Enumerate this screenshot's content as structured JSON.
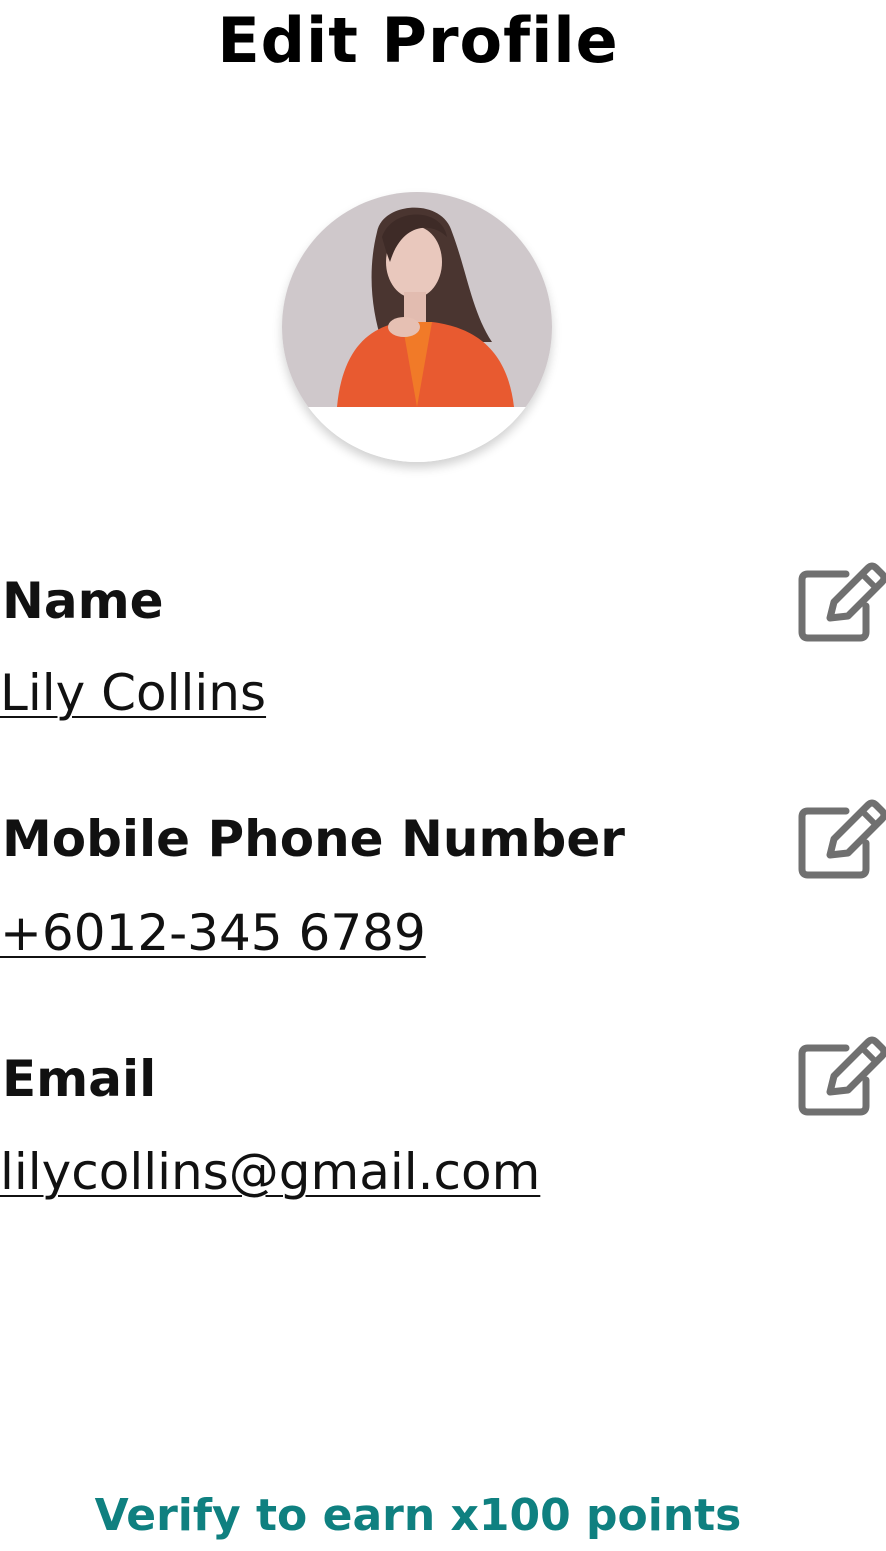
{
  "header": {
    "title": "Edit Profile"
  },
  "avatar": {
    "label": "profile-photo"
  },
  "fields": [
    {
      "label": "Name",
      "value": "Lily Collins",
      "edit_icon": "pencil-square-icon"
    },
    {
      "label": "Mobile Phone Number",
      "value": "+6012-345 6789",
      "edit_icon": "pencil-square-icon"
    },
    {
      "label": "Email",
      "value": "lilycollins@gmail.com",
      "edit_icon": "pencil-square-icon"
    }
  ],
  "footer": {
    "verify_label": "Verify to earn x100 points"
  },
  "colors": {
    "accent": "#0f8080",
    "icon": "#707070",
    "text": "#111111"
  }
}
